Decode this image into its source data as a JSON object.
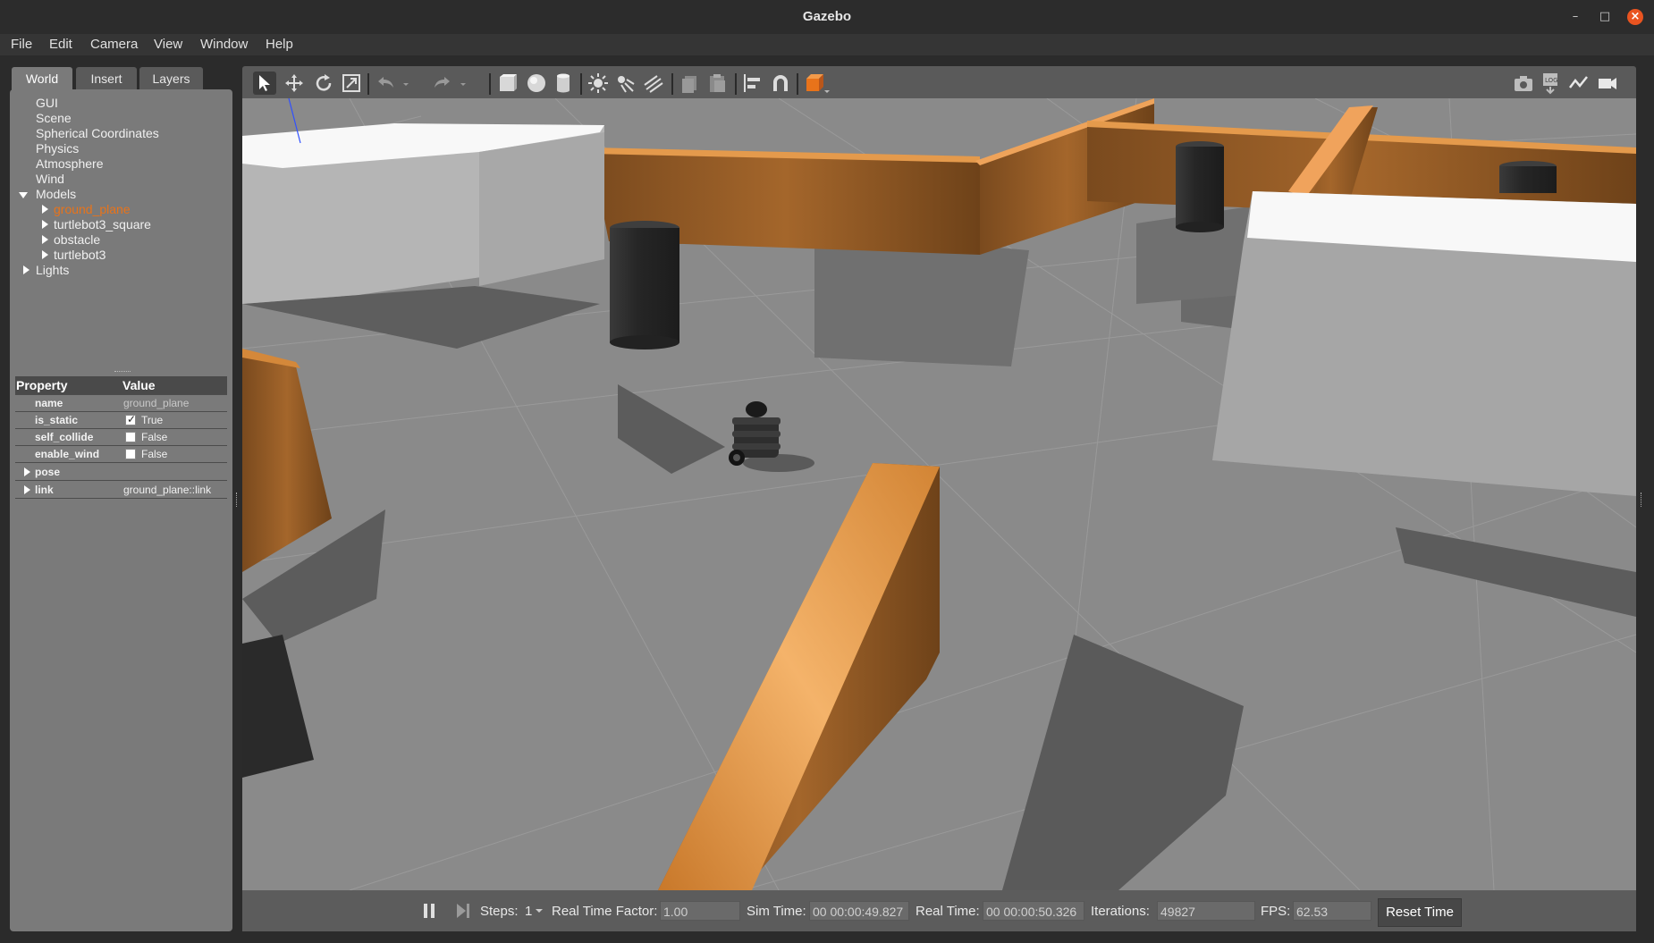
{
  "window": {
    "title": "Gazebo"
  },
  "menubar": {
    "items": [
      "File",
      "Edit",
      "Camera",
      "View",
      "Window",
      "Help"
    ]
  },
  "left_panel": {
    "tabs": [
      "World",
      "Insert",
      "Layers"
    ],
    "active_tab": "World",
    "tree": {
      "gui": "GUI",
      "scene": "Scene",
      "spherical": "Spherical Coordinates",
      "physics": "Physics",
      "atmosphere": "Atmosphere",
      "wind": "Wind",
      "models": "Models",
      "model_items": [
        "ground_plane",
        "turtlebot3_square",
        "obstacle",
        "turtlebot3"
      ],
      "selected_model": "ground_plane",
      "lights": "Lights"
    },
    "properties": {
      "header": {
        "property": "Property",
        "value": "Value"
      },
      "rows": [
        {
          "name": "name",
          "value": "ground_plane",
          "type": "text"
        },
        {
          "name": "is_static",
          "value": "True",
          "type": "checkbox",
          "checked": true
        },
        {
          "name": "self_collide",
          "value": "False",
          "type": "checkbox",
          "checked": false
        },
        {
          "name": "enable_wind",
          "value": "False",
          "type": "checkbox",
          "checked": false
        },
        {
          "name": "pose",
          "value": "",
          "type": "group"
        },
        {
          "name": "link",
          "value": "ground_plane::link",
          "type": "group"
        }
      ]
    }
  },
  "toolbar": {
    "left_tools": [
      "select-mode",
      "translate-mode",
      "rotate-mode",
      "scale-mode",
      "undo",
      "redo",
      "box",
      "sphere",
      "cylinder",
      "point-light",
      "spot-light",
      "directional-light",
      "copy",
      "paste",
      "align",
      "snap",
      "view-angle"
    ],
    "right_tools": [
      "screenshot",
      "log",
      "plot",
      "record-video"
    ],
    "colors": {
      "accent": "#e8731a",
      "active_bg": "#3c3c3c"
    }
  },
  "bottom_bar": {
    "steps_label": "Steps:",
    "steps_value": "1",
    "rtf_label": "Real Time Factor:",
    "rtf_value": "1.00",
    "sim_time_label": "Sim Time:",
    "sim_time_value": "00 00:00:49.827",
    "real_time_label": "Real Time:",
    "real_time_value": "00 00:00:50.326",
    "iterations_label": "Iterations:",
    "iterations_value": "49827",
    "fps_label": "FPS:",
    "fps_value": "62.53",
    "reset_label": "Reset Time"
  },
  "colors": {
    "selected_tree_item": "#e8731a",
    "close_button": "#e95420"
  }
}
